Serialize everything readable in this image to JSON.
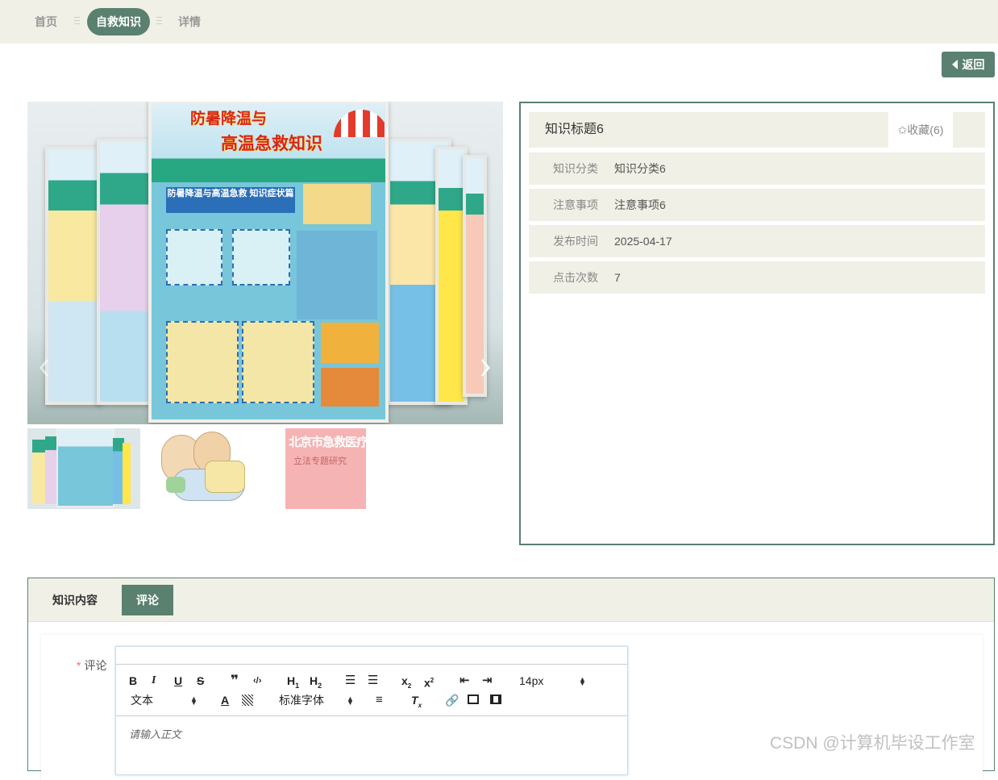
{
  "breadcrumb": {
    "items": [
      "首页",
      "自救知识",
      "详情"
    ]
  },
  "actions": {
    "back_label": "返回"
  },
  "detail": {
    "title": "知识标题6",
    "favorite_label": "✩收藏(6)",
    "fields": [
      {
        "label": "知识分类",
        "value": "知识分类6"
      },
      {
        "label": "注意事项",
        "value": "注意事项6"
      },
      {
        "label": "发布时间",
        "value": "2025-04-17"
      },
      {
        "label": "点击次数",
        "value": "7"
      }
    ]
  },
  "carousel": {
    "poster_title_line1": "防暑降温与",
    "poster_title_line2": "高温急救知识",
    "poster_subtitle": "防暑降温与高温急救 知识症状篇",
    "thumbnail_3_text": "北京市急救医疗服务",
    "thumbnail_3_subtext": "立法专题研究"
  },
  "tabs": [
    "知识内容",
    "评论"
  ],
  "comment_form": {
    "required_mark": "*",
    "label": "评论",
    "font_size": "14px",
    "paragraph_style": "文本",
    "font_family": "标准字体",
    "placeholder": "请输入正文"
  },
  "watermark": "CSDN @计算机毕设工作室",
  "colors": {
    "accent": "#5a8070",
    "panel_bg": "#f1f0e6"
  }
}
